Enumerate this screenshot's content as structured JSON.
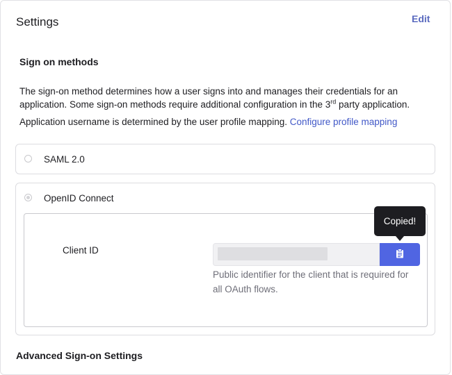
{
  "header": {
    "title": "Settings",
    "edit_label": "Edit"
  },
  "sign_on": {
    "heading": "Sign on methods",
    "description_part1": "The sign-on method determines how a user signs into and manages their credentials for an application. Some sign-on methods require additional configuration in the 3",
    "description_sup": "rd",
    "description_part2": " party application.",
    "username_text": "Application username is determined by the user profile mapping.",
    "username_link": "Configure profile mapping"
  },
  "methods": {
    "saml_label": "SAML 2.0",
    "oidc_label": "OpenID Connect",
    "selected": "OpenID Connect"
  },
  "client": {
    "label": "Client ID",
    "value": "",
    "help": "Public identifier for the client that is required for all OAuth flows.",
    "copy_icon": "clipboard-icon",
    "tooltip": "Copied!"
  },
  "advanced": {
    "heading": "Advanced Sign-on Settings"
  },
  "colors": {
    "accent": "#5065e2",
    "link": "#4158c7",
    "edit": "#5a6abf",
    "tooltip_bg": "#1d1d21"
  }
}
